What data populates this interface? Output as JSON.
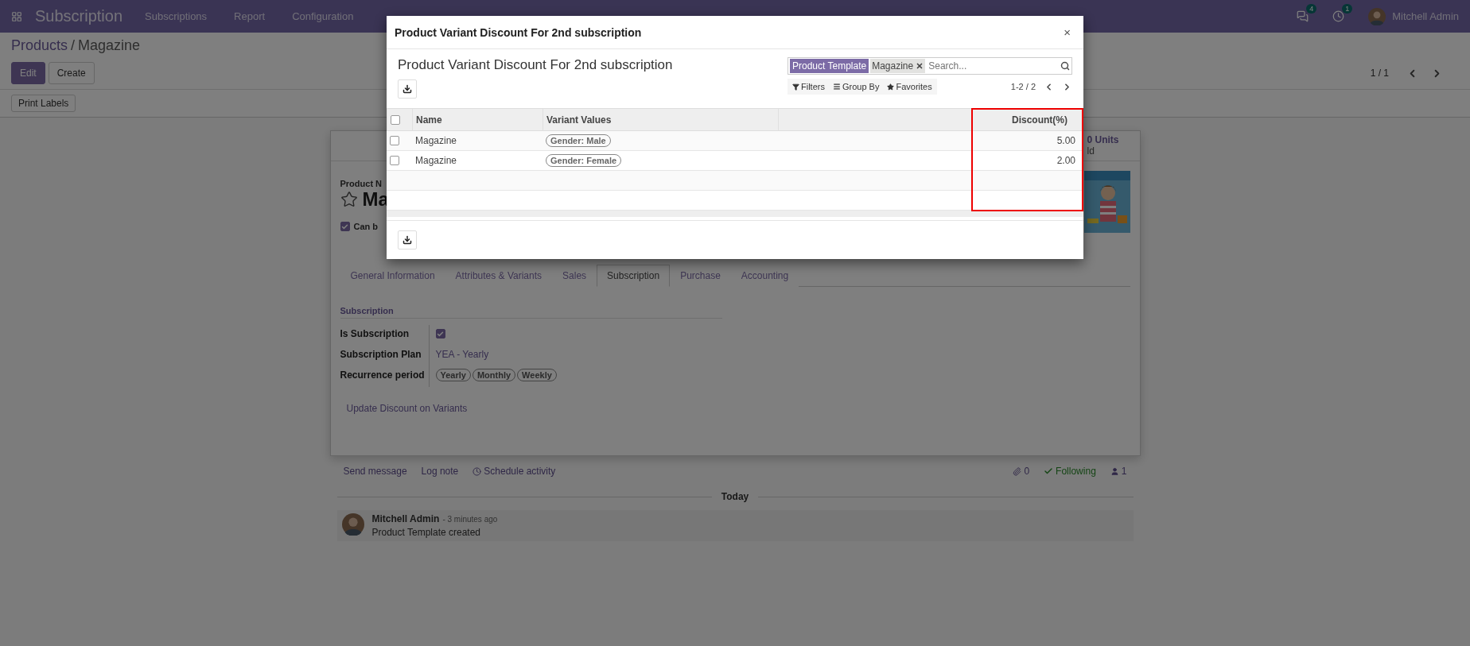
{
  "navbar": {
    "app_title": "Subscription",
    "menu": [
      "Subscriptions",
      "Report",
      "Configuration"
    ],
    "messages_badge": "4",
    "activities_badge": "1",
    "user": "Mitchell Admin"
  },
  "control_panel": {
    "breadcrumb": [
      "Products",
      "Magazine"
    ],
    "separator": "/",
    "buttons": [
      "Edit",
      "Create"
    ],
    "action_buttons": [
      "Print Labels"
    ],
    "pager": "1 / 1"
  },
  "sheet": {
    "stat_value": "0 Units",
    "stat_label": "ld",
    "product_name_label": "Product N",
    "title": "Ma",
    "can_be": {
      "label": "Can b",
      "checked": true
    },
    "tabs": [
      {
        "label": "General Information",
        "selected": false
      },
      {
        "label": "Attributes & Variants",
        "selected": false
      },
      {
        "label": "Sales",
        "selected": false
      },
      {
        "label": "Subscription",
        "selected": true
      },
      {
        "label": "Purchase",
        "selected": false
      },
      {
        "label": "Accounting",
        "selected": false
      }
    ],
    "section": "Subscription",
    "fields": [
      {
        "kind": "checkbox",
        "label": "Is Subscription",
        "checked": true
      },
      {
        "kind": "text",
        "label": "Subscription Plan",
        "value": "YEA - Yearly"
      },
      {
        "kind": "tags",
        "label": "Recurrence period",
        "tags": [
          "Yearly",
          "Monthly",
          "Weekly"
        ]
      }
    ],
    "link": "Update Discount on Variants"
  },
  "chatter": {
    "actions": [
      "Send message",
      "Log note",
      "Schedule activity"
    ],
    "attachments": "0",
    "following": "Following",
    "followers": "1",
    "date": "Today",
    "message": {
      "author": "Mitchell Admin",
      "time": "- 3 minutes ago",
      "body": "Product Template created"
    }
  },
  "modal": {
    "title": "Product Variant Discount For 2nd subscription",
    "list_title": "Product Variant Discount For 2nd subscription",
    "facet": {
      "field": "Product Template",
      "value": "Magazine"
    },
    "search_placeholder": "Search...",
    "filters": [
      "Filters",
      "Group By",
      "Favorites"
    ],
    "pager": "1-2 / 2",
    "select_all": {
      "checked": false
    },
    "columns": [
      "Name",
      "Variant Values",
      "Discount(%)"
    ],
    "rows": [
      {
        "checked": false,
        "name": "Magazine",
        "variant": "Gender: Male",
        "discount": "5.00"
      },
      {
        "checked": false,
        "name": "Magazine",
        "variant": "Gender: Female",
        "discount": "2.00"
      }
    ],
    "close": "×"
  }
}
